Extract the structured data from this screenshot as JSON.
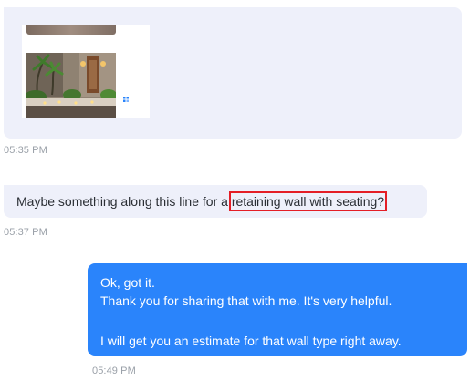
{
  "messages": {
    "incoming_image": {
      "timestamp": "05:35 PM"
    },
    "incoming_text": {
      "text_before": "Maybe something along this line for a ",
      "highlighted": "retaining wall with seating?",
      "timestamp": "05:37 PM"
    },
    "outgoing_text": {
      "line1": "Ok, got it.",
      "line2": "Thank you for sharing that with me. It's very helpful.",
      "line3": "I will get you an estimate for that wall type right away.",
      "timestamp": "05:49 PM"
    }
  },
  "colors": {
    "incoming_bubble": "#eef0fa",
    "outgoing_bubble": "#2a84fb",
    "highlight_border": "#e41e26",
    "timestamp_text": "#9aa0a8"
  }
}
